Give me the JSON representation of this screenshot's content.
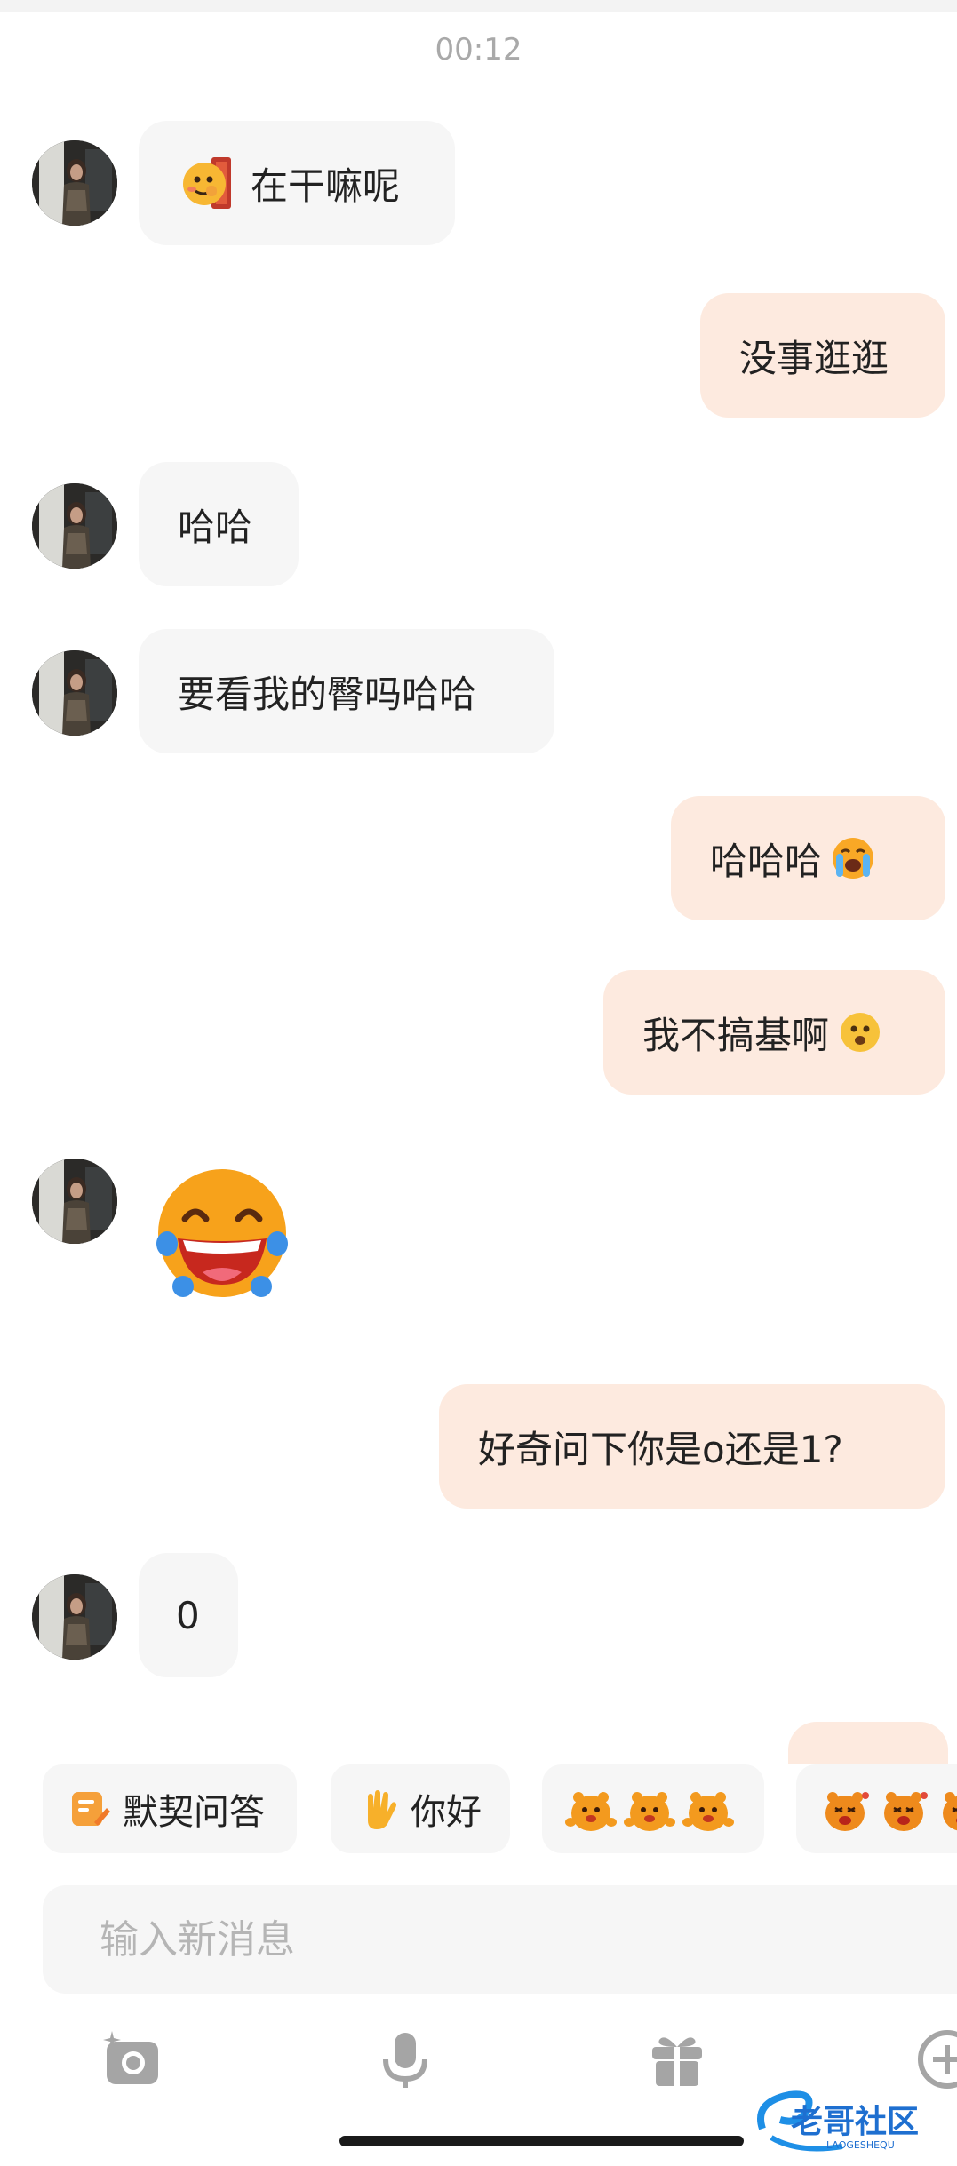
{
  "timestamp": "00:12",
  "messages": [
    {
      "side": "in",
      "text": "在干嘛呢",
      "lead_emoji": "peek-face-emoji"
    },
    {
      "side": "out",
      "text": "没事逛逛"
    },
    {
      "side": "in",
      "text": "哈哈"
    },
    {
      "side": "in",
      "text": "要看我的臀吗哈哈"
    },
    {
      "side": "out",
      "text": "哈哈哈",
      "trail_emoji": "loudly-crying-face-emoji"
    },
    {
      "side": "out",
      "text": "我不搞基啊",
      "trail_emoji": "frowning-face-emoji"
    },
    {
      "side": "in",
      "sticker": "laughing-tears-face-emoji"
    },
    {
      "side": "out",
      "text": "好奇问下你是o还是1?"
    },
    {
      "side": "in",
      "text": "0"
    }
  ],
  "quick_replies": [
    {
      "label": "默契问答",
      "icon": "quiz-note-icon"
    },
    {
      "label": "你好",
      "icon": "waving-hand-icon"
    },
    {
      "label": "",
      "icon": "dancing-bear-stickers"
    },
    {
      "label": "",
      "icon": "crying-bear-stickers"
    }
  ],
  "input": {
    "placeholder": "输入新消息",
    "value": ""
  },
  "toolbar": [
    "camera-icon",
    "microphone-icon",
    "gift-icon",
    "plus-icon"
  ],
  "watermark": {
    "title": "老哥社区",
    "subtitle": "LAOGESHEQU"
  },
  "colors": {
    "incoming_bubble": "#f6f6f6",
    "outgoing_bubble": "#fdeadf",
    "text": "#222222",
    "timestamp": "#a9a9a9",
    "placeholder": "#b5b5b5",
    "icon_gray": "#9c9c9c"
  }
}
